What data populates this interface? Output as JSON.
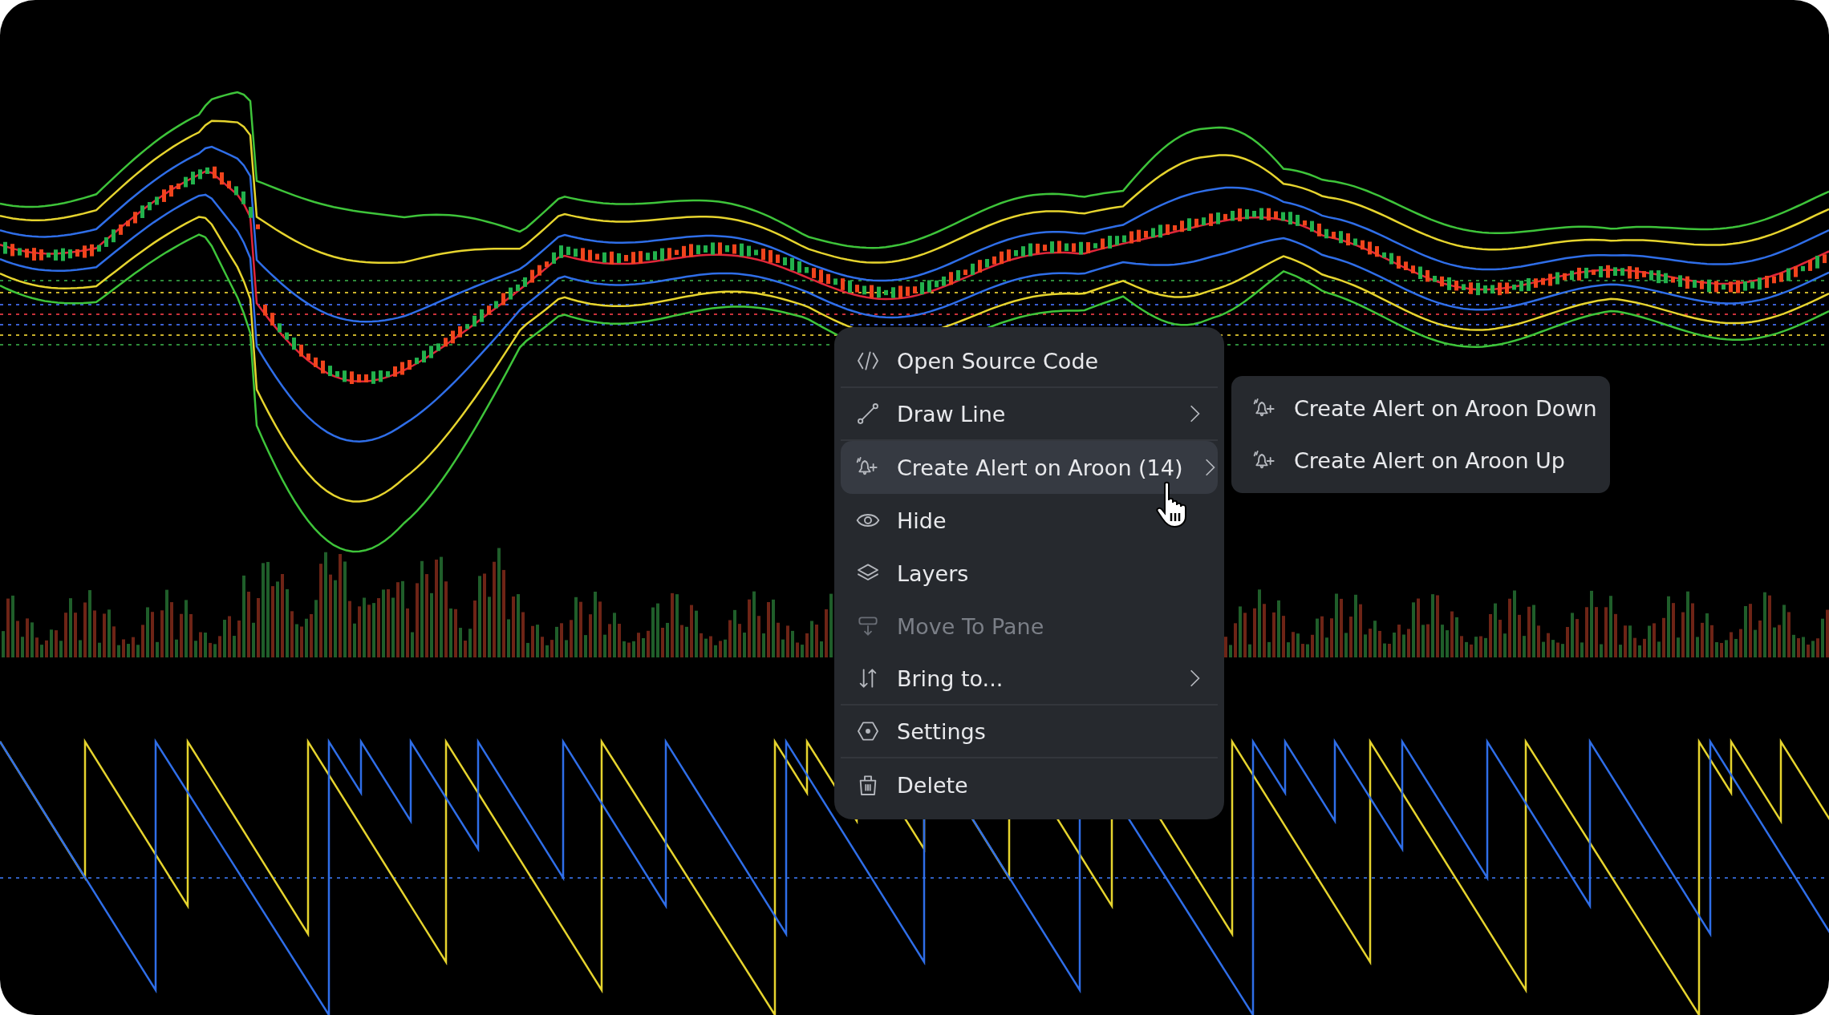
{
  "context_menu": {
    "items": [
      {
        "kind": "code",
        "label": "Open Source Code",
        "submenu": false,
        "disabled": false,
        "selected": false,
        "divider_after": true
      },
      {
        "kind": "line",
        "label": "Draw Line",
        "submenu": true,
        "disabled": false,
        "selected": false,
        "divider_after": true
      },
      {
        "kind": "alert",
        "label": "Create Alert on Aroon (14)",
        "submenu": true,
        "disabled": false,
        "selected": true,
        "divider_after": false
      },
      {
        "kind": "eye",
        "label": "Hide",
        "submenu": false,
        "disabled": false,
        "selected": false,
        "divider_after": false
      },
      {
        "kind": "layers",
        "label": "Layers",
        "submenu": false,
        "disabled": false,
        "selected": false,
        "divider_after": false
      },
      {
        "kind": "pane",
        "label": "Move To Pane",
        "submenu": false,
        "disabled": true,
        "selected": false,
        "divider_after": false
      },
      {
        "kind": "sort",
        "label": "Bring to...",
        "submenu": true,
        "disabled": false,
        "selected": false,
        "divider_after": true
      },
      {
        "kind": "settings",
        "label": "Settings",
        "submenu": false,
        "disabled": false,
        "selected": false,
        "divider_after": true
      },
      {
        "kind": "trash",
        "label": "Delete",
        "submenu": false,
        "disabled": false,
        "selected": false,
        "divider_after": false
      }
    ]
  },
  "submenu": {
    "items": [
      {
        "kind": "alert",
        "label": "Create Alert on Aroon Down"
      },
      {
        "kind": "alert",
        "label": "Create Alert on Aroon Up"
      }
    ]
  }
}
